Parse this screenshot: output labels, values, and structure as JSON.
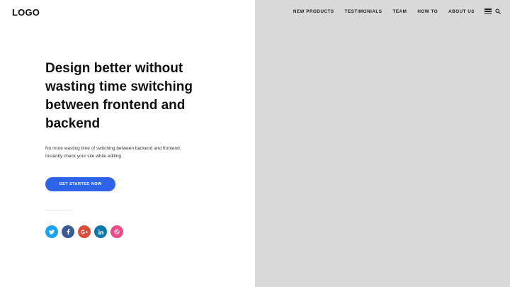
{
  "header": {
    "logo": "LOGO",
    "nav": [
      "NEW PRODUCTS",
      "TESTIMONIALS",
      "TEAM",
      "HOW TO",
      "ABOUT US"
    ],
    "menu_icon": "hamburger-icon",
    "search_icon": "search-icon"
  },
  "hero": {
    "headline": "Design better without wasting time switching between frontend and backend",
    "subtext": "No more wasting time of switching between backend and frontend. Instantly check your site while editing.",
    "cta_label": "GET STARTED NOW"
  },
  "social": [
    {
      "name": "twitter-icon",
      "color": "#1da1f2"
    },
    {
      "name": "facebook-icon",
      "color": "#3b5998"
    },
    {
      "name": "google-plus-icon",
      "color": "#dd4b39"
    },
    {
      "name": "linkedin-icon",
      "color": "#0e76a8"
    },
    {
      "name": "dribbble-icon",
      "color": "#ea4c89"
    }
  ],
  "colors": {
    "accent": "#2f64e8",
    "image_placeholder": "#d9d9d9"
  }
}
